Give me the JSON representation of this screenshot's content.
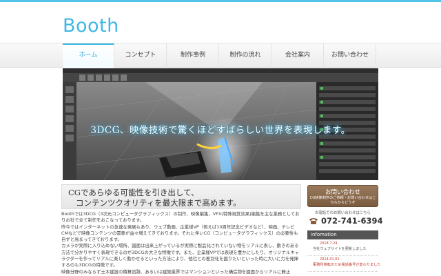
{
  "site": {
    "logo": "Booth"
  },
  "nav": {
    "items": [
      {
        "label": "ホーム",
        "active": true
      },
      {
        "label": "コンセプト"
      },
      {
        "label": "制作事例"
      },
      {
        "label": "制作の流れ"
      },
      {
        "label": "会社案内"
      },
      {
        "label": "お問い合わせ"
      }
    ]
  },
  "hero": {
    "caption": "3DCG、映像技術で驚くほどすばらしい世界を表現します。"
  },
  "headline": {
    "line1": "CGであらゆる可能性を引き出して、",
    "line2": "コンテンツクオリティを最大限まで高めます。"
  },
  "body": {
    "paragraphs": [
      "Boothでは3DCG（3次元コンピュータグラフィックス）の制作、映像編集、VFX(特殊視覚効果)編集を主な業務としておりお社で全て制作をおこなっております。",
      "昨今ではインターネットの急速な発展もあり、ウェブ動画、企業様VP（例えば10周年記念ビデオなど）、映画、テレビCMなどで映像コンテンツの需要が益々増えてきております。それに伴いCG（コンピュータグラフィックス）の必要性も自ずと高まってきております。",
      "カメラが実際に入り込めない場所、図面は出来上がっているが実際に製品化されていない物をリアルに表し、動きのある方法で分かりやすく表現できるのが3DCGの大きな特徴です。また、企業様VPでは表現を豊かにしたり、オリジナルキャラクターを作ってリアルに楽しく動かせるといった方法により、他社との差別化を図りたいといった時に大いに力を発揮するのも3DCGの特徴です。",
      "映像分野のみならず土木建設の積算追跡、あるいは建築業界ではマンションといった構造物を図面からリアルに静止"
    ]
  },
  "sidebar": {
    "contact_title": "お問い合わせ",
    "contact_sub": "CG映像制作のご依頼・お問い合わせはこちらからどうぞ",
    "tel_label": "お電話でのお問い合わせはこちら",
    "tel_number": "072-741-6394",
    "info_heading": "infomation",
    "info": [
      {
        "date": "2018.7.24",
        "text": "当社ウェブサイトを更新しました"
      },
      {
        "date": "2014.01.01",
        "text": "事務所移転のため電話番号が変わりました"
      }
    ]
  },
  "colors": {
    "accent": "#3fb7e6",
    "brown": "#8a6a4e"
  }
}
